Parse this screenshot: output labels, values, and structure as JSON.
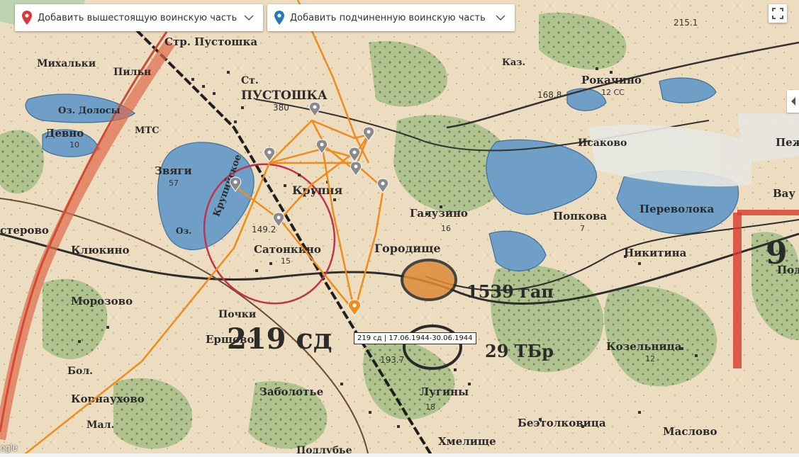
{
  "controls": {
    "superior_placeholder": "Добавить вышестоящую воинскую часть",
    "subordinate_placeholder": "Добавить подчиненную воинскую часть",
    "superior_pin_color": "#e0343b",
    "subordinate_pin_color": "#2979b7"
  },
  "tooltip": {
    "text": "219 сд | 17.06.1944-30.06.1944"
  },
  "attribution": {
    "text": "ogle"
  },
  "route_color": "#f08c1c",
  "active_marker_color": "#f08c1c",
  "map_labels": {
    "pustoshka_st": "Стр. Пустошка",
    "pustoshka": "ПУСТОШКА",
    "st": "Ст.",
    "n380": "380",
    "mikhalki": "Михальки",
    "pilni": "Пильн",
    "oz_dolosy": "Оз. Долосы",
    "devno": "Девно",
    "n10": "10",
    "mts": "МТС",
    "zvagi": "Звяги",
    "n57": "57",
    "krupiya": "Крупня",
    "krupiyskoe": "Крупийское",
    "oz": "Оз.",
    "n149": "149.2",
    "satonkino": "Сатонкино",
    "n15": "15",
    "sterovo": "стерово",
    "klyukino": "Клюкино",
    "morozovo": "Морозово",
    "pochki": "Почки",
    "ershovo": "Ершово",
    "sd219": "219 сд",
    "bol": "Бол.",
    "kornaukhovo": "Корнаухово",
    "mal": "Мал.",
    "zabolotye": "Заболотье",
    "lugini": "Лугины",
    "n18": "18",
    "n193": "193.7",
    "podlubye": "Подлубье",
    "khmelishche": "Хмелище",
    "beztolkovitsa": "Беэтолковица",
    "maslovo": "Маслово",
    "kozelnitsa": "Козельница",
    "n12": "12",
    "tbr29": "29 ТБр",
    "gap1539": "1539 гап",
    "gorodishche": "Городище",
    "galuzino": "Галузино",
    "n16": "16",
    "popkova": "Попкова",
    "n7": "7",
    "nikitina": "Никитина",
    "perevoloka": "Переволока",
    "isakovo": "Исаково",
    "rokachino": "Рокачино",
    "ss12": "12 СС",
    "n168": "168.8",
    "kaz": "Каз.",
    "n215": "215.1",
    "pezhe": "Пеже",
    "vau": "Вау",
    "pod": "Под",
    "n9": "9"
  }
}
